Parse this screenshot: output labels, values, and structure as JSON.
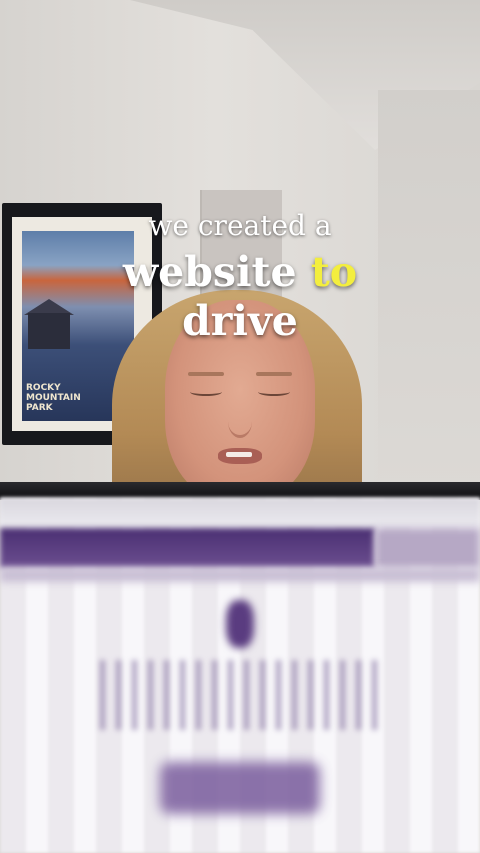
{
  "caption": {
    "line1": "we created a",
    "line2_word1": "website",
    "line2_word2": "to",
    "line3": "drive"
  },
  "poster": {
    "lines": [
      "ROCKY",
      "MOUNTAIN",
      "PARK"
    ]
  },
  "colors": {
    "caption_text": "#ffffff",
    "caption_highlight": "#f3ee3e",
    "screen_accent": "#4a2f72"
  }
}
